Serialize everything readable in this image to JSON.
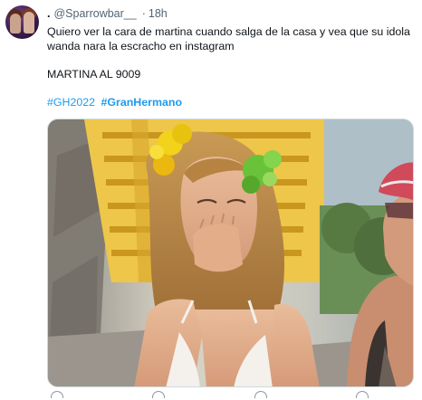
{
  "tweet": {
    "author_name": ".",
    "author_handle": "@Sparrowbar__",
    "separator": "·",
    "timestamp": "18h",
    "text": "Quiero ver la cara de martina cuando salga de la casa y vea que su idola wanda nara la escracho en instagram",
    "text2": "MARTINA AL 9009",
    "hashtags": [
      "#GH2022",
      "#GranHermano"
    ]
  },
  "icons": {
    "reply": "reply-icon",
    "retweet": "retweet-icon",
    "like": "like-icon",
    "share": "share-icon"
  },
  "colors": {
    "link": "#1d9bf0",
    "text": "#0f1419",
    "muted": "#536471"
  }
}
